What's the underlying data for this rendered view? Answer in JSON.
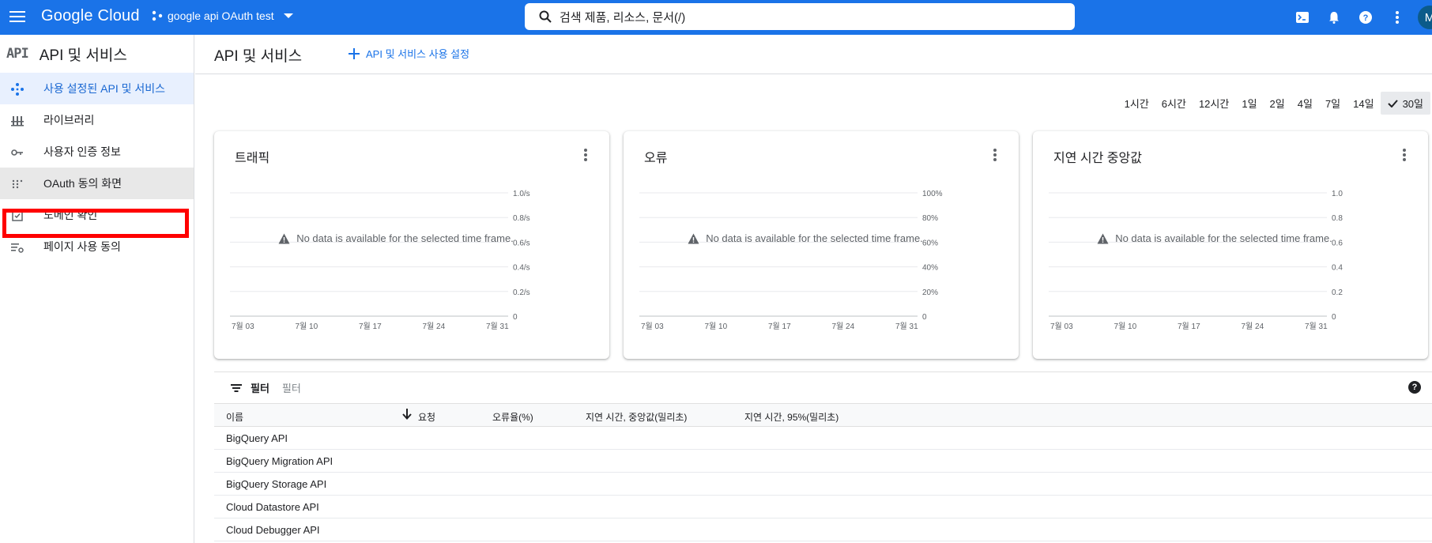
{
  "topbar": {
    "logo": "Google Cloud",
    "project": "google api OAuth test",
    "search_placeholder": "검색   제품, 리소스, 문서(/)",
    "avatar_initial": "M"
  },
  "sidebar": {
    "title": "API 및 서비스",
    "api_mark": "API",
    "items": [
      {
        "label": "사용 설정된 API 및 서비스",
        "icon": "diamond-nodes-icon"
      },
      {
        "label": "라이브러리",
        "icon": "library-icon"
      },
      {
        "label": "사용자 인증 정보",
        "icon": "key-icon"
      },
      {
        "label": "OAuth 동의 화면",
        "icon": "dots-grid-icon"
      },
      {
        "label": "도메인 확인",
        "icon": "checkbox-icon"
      },
      {
        "label": "페이지 사용 동의",
        "icon": "settings-list-icon"
      }
    ]
  },
  "main": {
    "title": "API 및 서비스",
    "enable_button": "API 및 서비스 사용 설정",
    "ranges": [
      "1시간",
      "6시간",
      "12시간",
      "1일",
      "2일",
      "4일",
      "7일",
      "14일",
      "30일"
    ],
    "selected_range": "30일"
  },
  "charts": [
    {
      "title": "트래픽",
      "yticks": [
        "1.0/s",
        "0.8/s",
        "0.6/s",
        "0.4/s",
        "0.2/s",
        "0"
      ],
      "no_data": "No data is available for the selected time frame."
    },
    {
      "title": "오류",
      "yticks": [
        "100%",
        "80%",
        "60%",
        "40%",
        "20%",
        "0"
      ],
      "no_data": "No data is available for the selected time frame."
    },
    {
      "title": "지연 시간 중앙값",
      "yticks": [
        "1.0",
        "0.8",
        "0.6",
        "0.4",
        "0.2",
        "0"
      ],
      "no_data": "No data is available for the selected time frame."
    }
  ],
  "xticks": [
    "7월 03",
    "7월 10",
    "7월 17",
    "7월 24",
    "7월 31"
  ],
  "table": {
    "filter_label": "필터",
    "filter_placeholder": "필터",
    "columns": [
      "이름",
      "요청",
      "오류율(%)",
      "지연 시간, 중앙값(밀리초)",
      "지연 시간, 95%(밀리초)"
    ],
    "rows": [
      "BigQuery API",
      "BigQuery Migration API",
      "BigQuery Storage API",
      "Cloud Datastore API",
      "Cloud Debugger API"
    ]
  },
  "colors": {
    "brand": "#1a73e8",
    "highlight": "#ff0000"
  }
}
